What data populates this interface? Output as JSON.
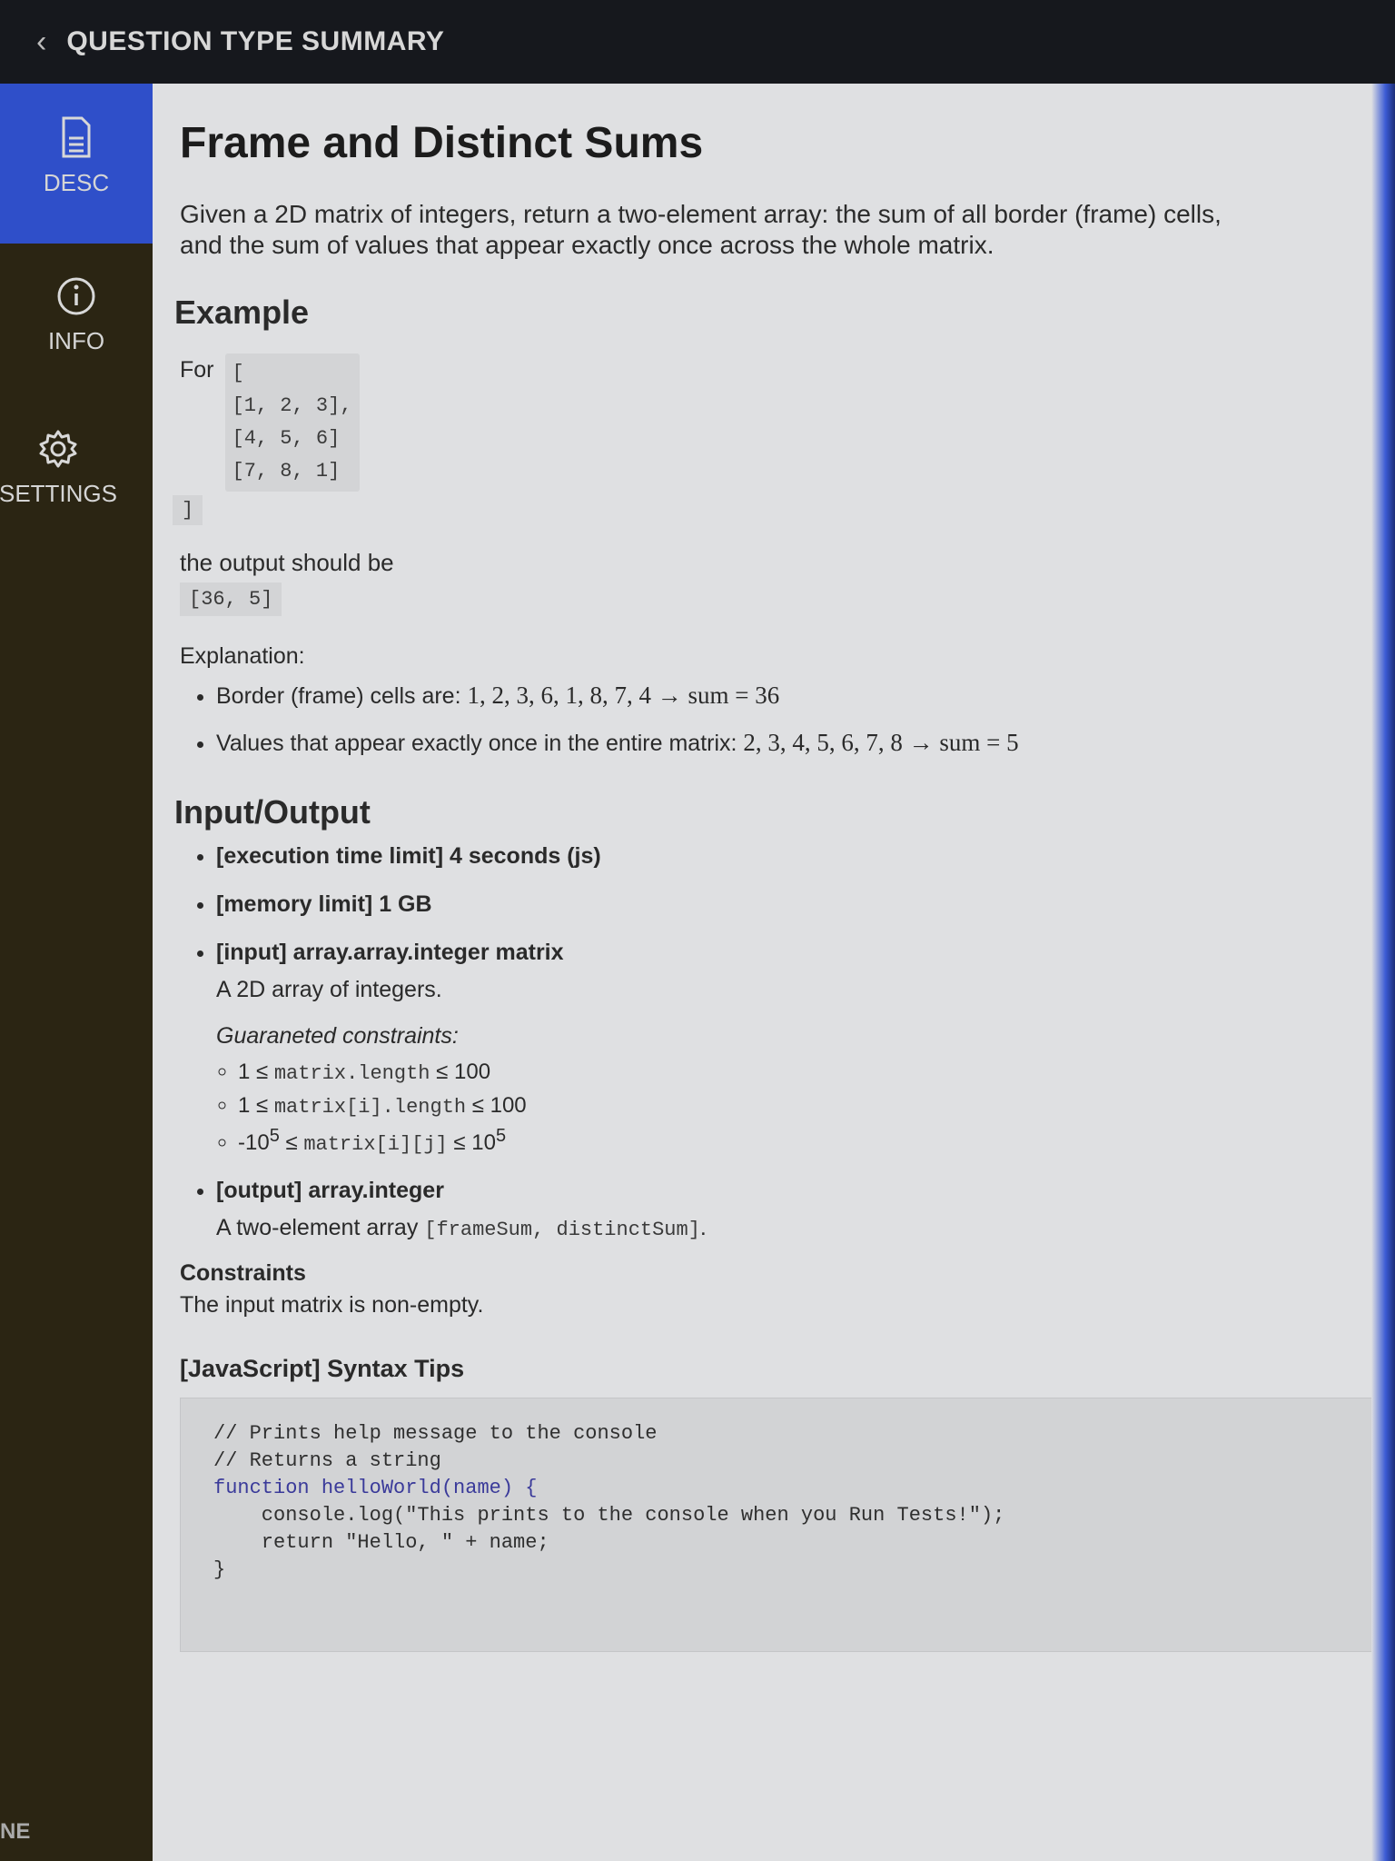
{
  "header": {
    "back_icon": "chevron-left-icon",
    "title": "QUESTION TYPE SUMMARY"
  },
  "sidebar": {
    "items": [
      {
        "label": "DESC",
        "icon": "document-icon",
        "active": true
      },
      {
        "label": "INFO",
        "icon": "info-icon",
        "active": false
      },
      {
        "label": "SETTINGS",
        "icon": "gear-icon",
        "active": false
      }
    ],
    "footer_text": "NE"
  },
  "main": {
    "title": "Frame and Distinct Sums",
    "description": "Given a 2D matrix of integers, return a two-element array: the sum of all border (frame) cells, and the sum of values that appear exactly once across the whole matrix.",
    "example_heading": "Example",
    "for_label": "For",
    "matrix_open": "[",
    "matrix_rows": [
      "[1, 2, 3],",
      "[4, 5, 6]",
      "[7, 8, 1]"
    ],
    "matrix_close": "]",
    "output_label": "the output should be",
    "output_value": "[36, 5]",
    "explanation_label": "Explanation:",
    "explanations": [
      {
        "text": "Border (frame) cells are: ",
        "math": "1, 2, 3, 6, 1, 8, 7, 4 → sum = 36"
      },
      {
        "text": "Values that appear exactly once in the entire matrix: ",
        "math": "2, 3, 4, 5, 6, 7, 8 → sum = 5"
      }
    ],
    "io_heading": "Input/Output",
    "time_limit": {
      "bold": "[execution time limit]",
      "rest": " 4 seconds (js)"
    },
    "memory_limit": {
      "bold": "[memory limit]",
      "rest": " 1 GB"
    },
    "input": {
      "label": "[input] array.array.integer matrix",
      "description": "A 2D array of integers.",
      "constraints_label": "Guaraneted constraints:",
      "constraints": [
        {
          "pre": "1 ≤ ",
          "code": "matrix.length",
          "post": " ≤ 100"
        },
        {
          "pre": "1 ≤ ",
          "code": "matrix[i].length",
          "post": " ≤ 100"
        },
        {
          "pre": "-10",
          "sup1": "5",
          "mid": " ≤ ",
          "code": "matrix[i][j]",
          "post": " ≤ 10",
          "sup2": "5"
        }
      ]
    },
    "output": {
      "label": "[output] array.integer",
      "desc_pre": "A two-element array ",
      "desc_code": "[frameSum, distinctSum]",
      "desc_post": "."
    },
    "constraints_heading": "Constraints",
    "constraints_text": "The input matrix is non-empty.",
    "syntax_heading": "[JavaScript] Syntax Tips",
    "code_lines": [
      "// Prints help message to the console",
      "// Returns a string",
      "function helloWorld(name) {",
      "    console.log(\"This prints to the console when you Run Tests!\");",
      "    return \"Hello, \" + name;",
      "}"
    ]
  },
  "colors": {
    "active_tab": "#2f4fc9",
    "topbar": "#16181d",
    "content_bg": "#dfe0e2"
  }
}
